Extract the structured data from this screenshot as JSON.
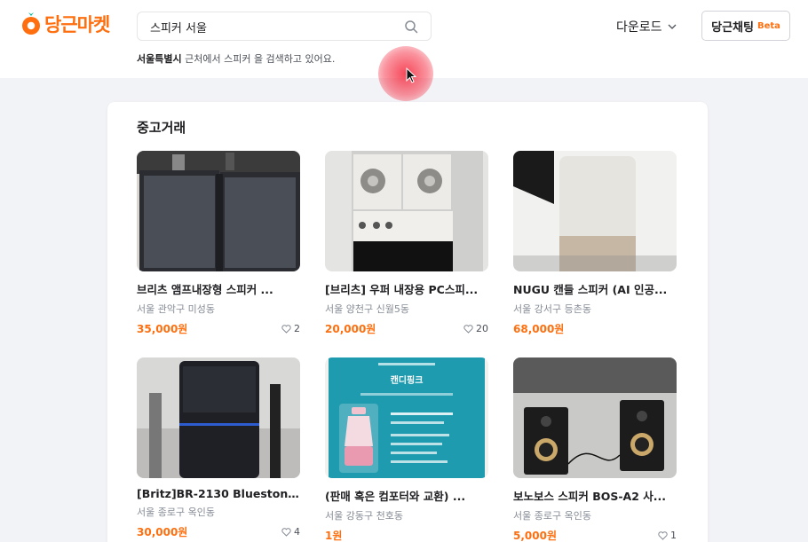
{
  "header": {
    "logo_text": "당근마켓",
    "search": {
      "value": "스피커 서울",
      "placeholder": ""
    },
    "location_caption": {
      "region": "서울특별시",
      "rest": " 근처에서 스피커 을 검색하고 있어요."
    },
    "download_label": "다운로드",
    "chat_label": "당근채팅",
    "beta_label": "Beta"
  },
  "section": {
    "title": "중고거래",
    "items": [
      {
        "title": "브리츠 앰프내장형 스피커 ...",
        "region": "서울 관악구 미성동",
        "price": "35,000원",
        "likes": "2",
        "image": "two-black-speakers"
      },
      {
        "title": "[브리츠] 우퍼 내장용 PC스피...",
        "region": "서울 양천구 신월5동",
        "price": "20,000원",
        "likes": "20",
        "image": "white-speaker-boxes"
      },
      {
        "title": "NUGU 캔들 스피커 (AI 인공...",
        "region": "서울 강서구 등촌동",
        "price": "68,000원",
        "likes": "",
        "image": "candle-speaker"
      },
      {
        "title": "[Britz]BR-2130 Bluestone/P...",
        "region": "서울 종로구 옥인동",
        "price": "30,000원",
        "likes": "4",
        "image": "tower-speaker"
      },
      {
        "title": "(판매 혹은 컴포터와 교환) ...",
        "region": "서울 강동구 천호동",
        "price": "1원",
        "likes": "",
        "image": "pink-lantern-poster",
        "poster": {
          "heading": "캔디핑크"
        }
      },
      {
        "title": "보노보스 스피커 BOS-A2 사...",
        "region": "서울 종로구 옥인동",
        "price": "5,000원",
        "likes": "1",
        "image": "small-black-speakers"
      }
    ]
  },
  "colors": {
    "brand": "#ff6f0f",
    "text": "#212124",
    "muted": "#868b94",
    "background": "#f2f3f6"
  }
}
